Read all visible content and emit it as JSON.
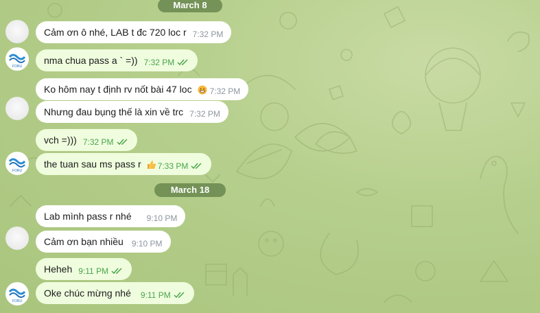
{
  "colors": {
    "incoming_bubble": "#ffffff",
    "outgoing_bubble": "#effdde",
    "outgoing_time": "#4aa44d",
    "incoming_time": "#8d969e",
    "date_pill": "#5f7d46"
  },
  "avatar": {
    "text": "FORU",
    "icon": "wave-logo-icon"
  },
  "dates": {
    "march8": "March 8",
    "march18": "March 18"
  },
  "messages": [
    {
      "text": "Cảm ơn ô nhé, LAB t đc 720 loc r",
      "time": "7:32 PM",
      "direction": "in"
    },
    {
      "text": "nma chua pass a ` =))",
      "time": "7:32 PM",
      "direction": "out",
      "status": "read"
    },
    {
      "text": "Ko hôm nay t định rv nốt bài 47 loc",
      "time": "7:32 PM",
      "direction": "in",
      "reaction": "grinning-face-icon"
    },
    {
      "text": "Nhưng đau bụng thế là xin về trc",
      "time": "7:32 PM",
      "direction": "in"
    },
    {
      "text": "vch =)))",
      "time": "7:32 PM",
      "direction": "out",
      "status": "read"
    },
    {
      "text": "the tuan sau ms pass r",
      "time": "7:33 PM",
      "direction": "out",
      "status": "read",
      "reaction": "thumbs-up-icon"
    },
    {
      "text": "Lab mình pass r nhé",
      "time": "9:10 PM",
      "direction": "in"
    },
    {
      "text": "Cảm ơn bạn nhiều",
      "time": "9:10 PM",
      "direction": "in"
    },
    {
      "text": "Heheh",
      "time": "9:11 PM",
      "direction": "out",
      "status": "read"
    },
    {
      "text": "Oke chúc mừng nhé",
      "time": "9:11 PM",
      "direction": "out",
      "status": "read"
    }
  ]
}
